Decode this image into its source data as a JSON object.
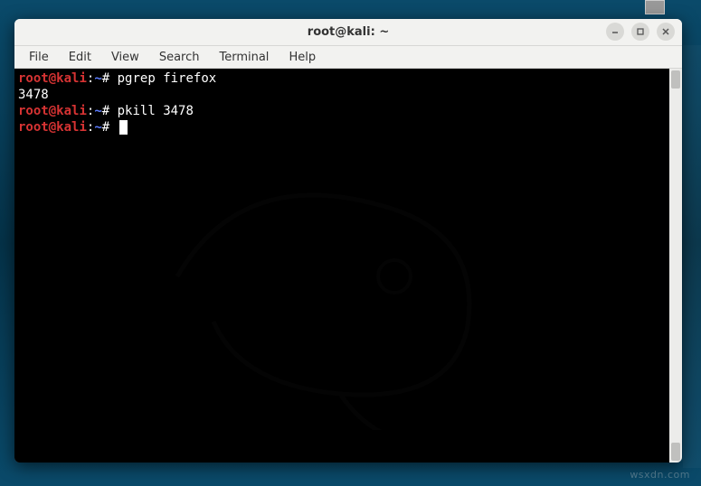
{
  "window": {
    "title": "root@kali: ~"
  },
  "menu": {
    "file": "File",
    "edit": "Edit",
    "view": "View",
    "search": "Search",
    "terminal": "Terminal",
    "help": "Help"
  },
  "prompt": {
    "user": "root",
    "at": "@",
    "host": "kali",
    "colon": ":",
    "path": "~",
    "hash": "#"
  },
  "terminal": {
    "lines": [
      {
        "cmd": "pgrep firefox"
      },
      {
        "output": "3478"
      },
      {
        "cmd": "pkill 3478"
      },
      {
        "cmd": "",
        "cursor": true
      }
    ]
  },
  "watermark": "wsxdn.com"
}
